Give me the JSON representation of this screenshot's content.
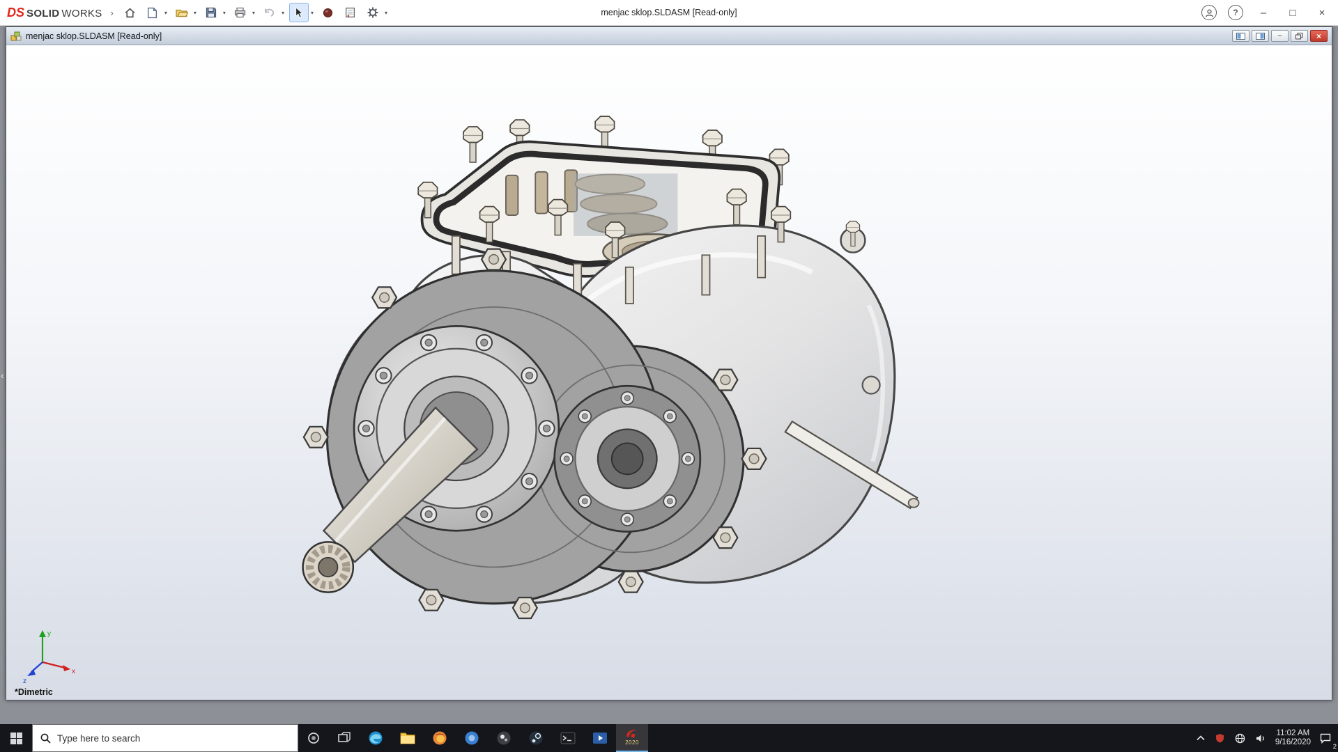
{
  "app": {
    "logo_mark": "DS",
    "logo_bold": "SOLID",
    "logo_light": "WORKS",
    "title": "menjac sklop.SLDASM [Read-only]"
  },
  "doc": {
    "title": "menjac sklop.SLDASM [Read-only]"
  },
  "viewport": {
    "orientation": "*Dimetric",
    "triad": {
      "x": "x",
      "y": "y",
      "z": "z"
    }
  },
  "taskbar": {
    "search_placeholder": "Type here to search",
    "clock_time": "11:02 AM",
    "clock_date": "9/16/2020",
    "notification_count": "2",
    "solidworks_year": "2020",
    "apps": [
      "edge",
      "file-explorer",
      "firefox",
      "chrome",
      "photos",
      "steam",
      "console",
      "movies",
      "solidworks"
    ]
  },
  "icons": {
    "flyout_arrow": "›",
    "collapse_pane": "‹",
    "dropdown_caret": "▾",
    "minimize": "–",
    "maximize": "□",
    "close": "×",
    "help": "?",
    "home": "house",
    "new_document": "page",
    "open": "folder",
    "save": "floppy-disk",
    "print": "printer",
    "undo": "undo-arrow",
    "select": "cursor-arrow",
    "appearance": "sphere",
    "sheet": "document",
    "options": "gear",
    "account": "person-circle",
    "search": "magnifier",
    "start": "windows-logo",
    "cortana": "circle",
    "task_view": "panels",
    "tray_chevron": "chevron-up",
    "network": "globe",
    "volume": "speaker",
    "action_center": "notification-square"
  }
}
